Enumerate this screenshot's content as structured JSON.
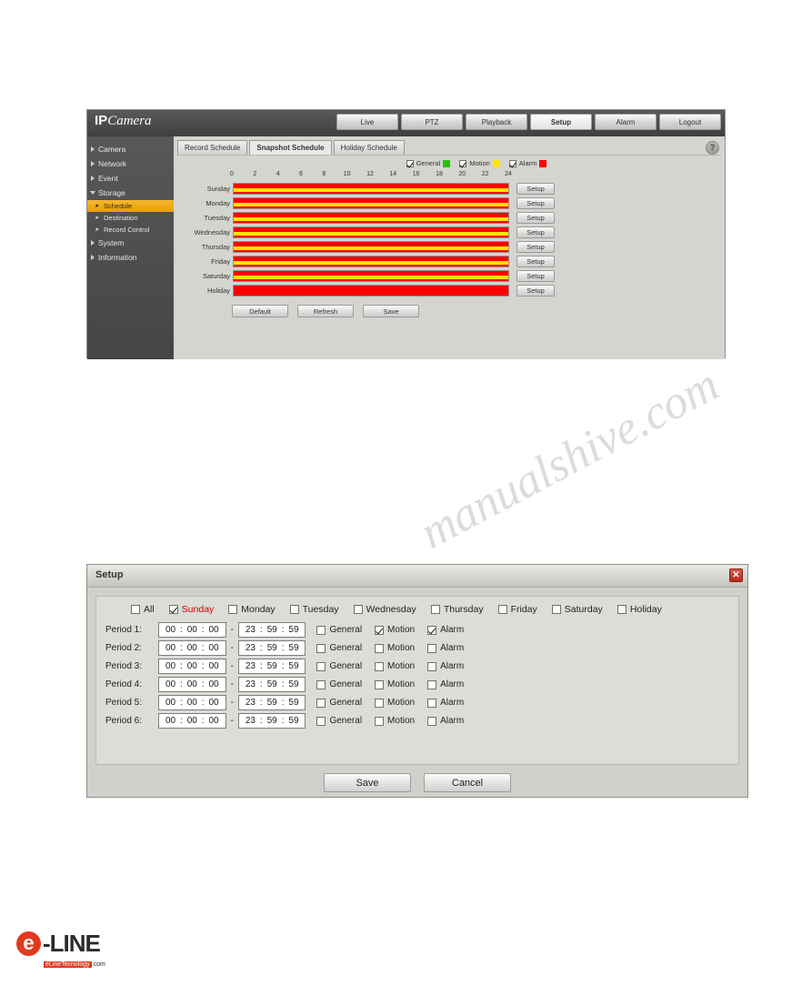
{
  "watermark": {
    "line1": "manualshive.com",
    "line2": "manualshive.com"
  },
  "ipcam": {
    "logo_ip": "IP",
    "logo_camera": "Camera",
    "nav": [
      {
        "label": "Live",
        "active": false
      },
      {
        "label": "PTZ",
        "active": false
      },
      {
        "label": "Playback",
        "active": false
      },
      {
        "label": "Setup",
        "active": true
      },
      {
        "label": "Alarm",
        "active": false
      },
      {
        "label": "Logout",
        "active": false
      }
    ],
    "sidebar": [
      {
        "label": "Camera",
        "type": "group",
        "open": false
      },
      {
        "label": "Network",
        "type": "group",
        "open": false
      },
      {
        "label": "Event",
        "type": "group",
        "open": false
      },
      {
        "label": "Storage",
        "type": "group",
        "open": true
      },
      {
        "label": "Schedule",
        "type": "sub",
        "selected": true
      },
      {
        "label": "Destination",
        "type": "sub",
        "selected": false
      },
      {
        "label": "Record Control",
        "type": "sub",
        "selected": false
      },
      {
        "label": "System",
        "type": "group",
        "open": false
      },
      {
        "label": "Information",
        "type": "group",
        "open": false
      }
    ],
    "tabs": [
      {
        "label": "Record Schedule",
        "active": false
      },
      {
        "label": "Snapshot Schedule",
        "active": true
      },
      {
        "label": "Holiday Schedule",
        "active": false
      }
    ],
    "help_icon": "?",
    "legend": [
      {
        "label": "General",
        "color": "#27c200",
        "checked": true
      },
      {
        "label": "Motion",
        "color": "#ffe400",
        "checked": true
      },
      {
        "label": "Alarm",
        "color": "#ff0000",
        "checked": true
      }
    ],
    "hours": [
      "0",
      "2",
      "4",
      "6",
      "8",
      "10",
      "12",
      "14",
      "16",
      "18",
      "20",
      "22",
      "24"
    ],
    "rows": [
      {
        "label": "Sunday",
        "setup": "Setup"
      },
      {
        "label": "Monday",
        "setup": "Setup"
      },
      {
        "label": "Tuesday",
        "setup": "Setup"
      },
      {
        "label": "Wednesday",
        "setup": "Setup"
      },
      {
        "label": "Thursday",
        "setup": "Setup"
      },
      {
        "label": "Friday",
        "setup": "Setup"
      },
      {
        "label": "Saturday",
        "setup": "Setup"
      },
      {
        "label": "Holiday",
        "setup": "Setup"
      }
    ],
    "buttons": [
      {
        "label": "Default"
      },
      {
        "label": "Refresh"
      },
      {
        "label": "Save"
      }
    ]
  },
  "dialog": {
    "title": "Setup",
    "close_icon": "close-icon",
    "days": [
      {
        "label": "All",
        "checked": false,
        "highlight": false
      },
      {
        "label": "Sunday",
        "checked": true,
        "highlight": true
      },
      {
        "label": "Monday",
        "checked": false,
        "highlight": false
      },
      {
        "label": "Tuesday",
        "checked": false,
        "highlight": false
      },
      {
        "label": "Wednesday",
        "checked": false,
        "highlight": false
      },
      {
        "label": "Thursday",
        "checked": false,
        "highlight": false
      },
      {
        "label": "Friday",
        "checked": false,
        "highlight": false
      },
      {
        "label": "Saturday",
        "checked": false,
        "highlight": false
      },
      {
        "label": "Holiday",
        "checked": false,
        "highlight": false
      }
    ],
    "periods": [
      {
        "label": "Period 1:",
        "start": [
          "00",
          "00",
          "00"
        ],
        "end": [
          "23",
          "59",
          "59"
        ],
        "events": [
          {
            "label": "General",
            "checked": false
          },
          {
            "label": "Motion",
            "checked": true
          },
          {
            "label": "Alarm",
            "checked": true
          }
        ]
      },
      {
        "label": "Period 2:",
        "start": [
          "00",
          "00",
          "00"
        ],
        "end": [
          "23",
          "59",
          "59"
        ],
        "events": [
          {
            "label": "General",
            "checked": false
          },
          {
            "label": "Motion",
            "checked": false
          },
          {
            "label": "Alarm",
            "checked": false
          }
        ]
      },
      {
        "label": "Period 3:",
        "start": [
          "00",
          "00",
          "00"
        ],
        "end": [
          "23",
          "59",
          "59"
        ],
        "events": [
          {
            "label": "General",
            "checked": false
          },
          {
            "label": "Motion",
            "checked": false
          },
          {
            "label": "Alarm",
            "checked": false
          }
        ]
      },
      {
        "label": "Period 4:",
        "start": [
          "00",
          "00",
          "00"
        ],
        "end": [
          "23",
          "59",
          "59"
        ],
        "events": [
          {
            "label": "General",
            "checked": false
          },
          {
            "label": "Motion",
            "checked": false
          },
          {
            "label": "Alarm",
            "checked": false
          }
        ]
      },
      {
        "label": "Period 5:",
        "start": [
          "00",
          "00",
          "00"
        ],
        "end": [
          "23",
          "59",
          "59"
        ],
        "events": [
          {
            "label": "General",
            "checked": false
          },
          {
            "label": "Motion",
            "checked": false
          },
          {
            "label": "Alarm",
            "checked": false
          }
        ]
      },
      {
        "label": "Period 6:",
        "start": [
          "00",
          "00",
          "00"
        ],
        "end": [
          "23",
          "59",
          "59"
        ],
        "events": [
          {
            "label": "General",
            "checked": false
          },
          {
            "label": "Motion",
            "checked": false
          },
          {
            "label": "Alarm",
            "checked": false
          }
        ]
      }
    ],
    "save_label": "Save",
    "cancel_label": "Cancel"
  },
  "footer": {
    "e": "e",
    "line": "-LINE",
    "sub_red": "eLineTecnology",
    "sub_black": ".com"
  }
}
